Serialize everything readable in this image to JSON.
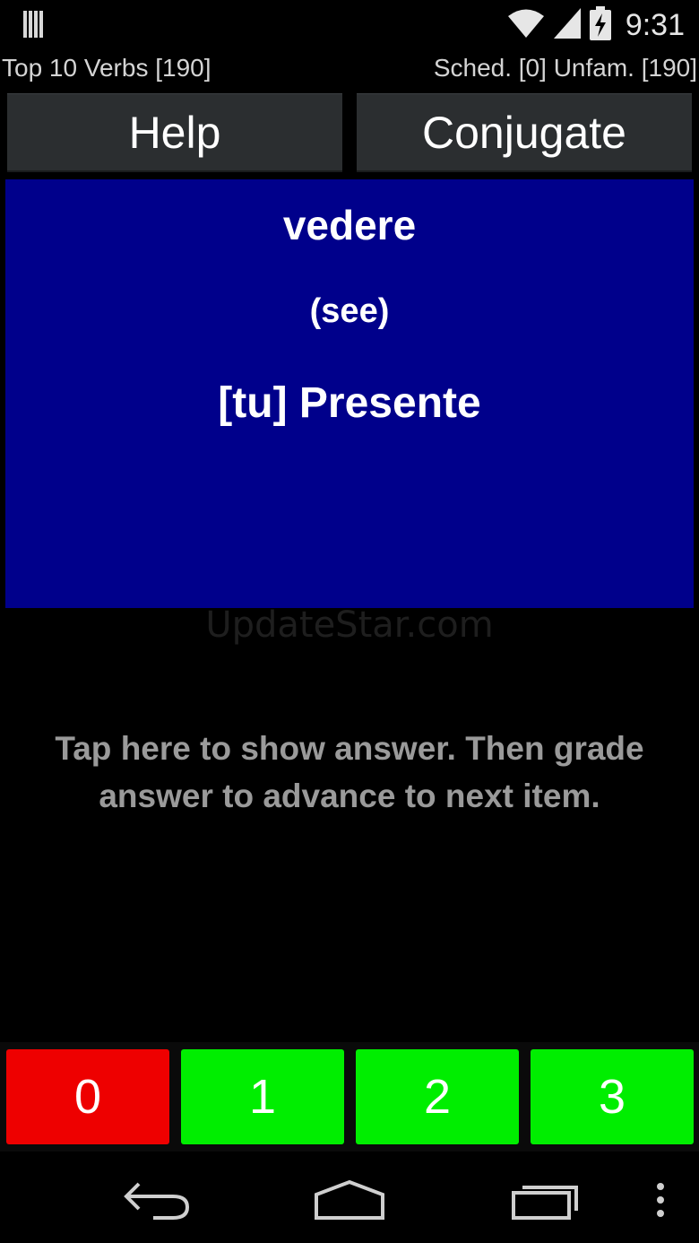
{
  "status_bar": {
    "time": "9:31",
    "icons": [
      "barcode-icon",
      "wifi-icon",
      "signal-icon",
      "battery-charging-icon"
    ]
  },
  "header": {
    "deck": "Top 10 Verbs [190]",
    "stats": "Sched. [0] Unfam. [190]"
  },
  "toolbar": {
    "help_label": "Help",
    "conjugate_label": "Conjugate"
  },
  "card": {
    "verb": "vedere",
    "translation": "(see)",
    "tense": "[tu] Presente",
    "background": "#00008b"
  },
  "watermark": "UpdateStar.com",
  "prompt": "Tap here to show answer. Then grade answer to advance to next item.",
  "grades": [
    {
      "label": "0",
      "color": "#ee0000"
    },
    {
      "label": "1",
      "color": "#00ee00"
    },
    {
      "label": "2",
      "color": "#00ee00"
    },
    {
      "label": "3",
      "color": "#00ee00"
    }
  ],
  "nav": [
    "back-icon",
    "home-icon",
    "recents-icon",
    "overflow-menu-icon"
  ]
}
